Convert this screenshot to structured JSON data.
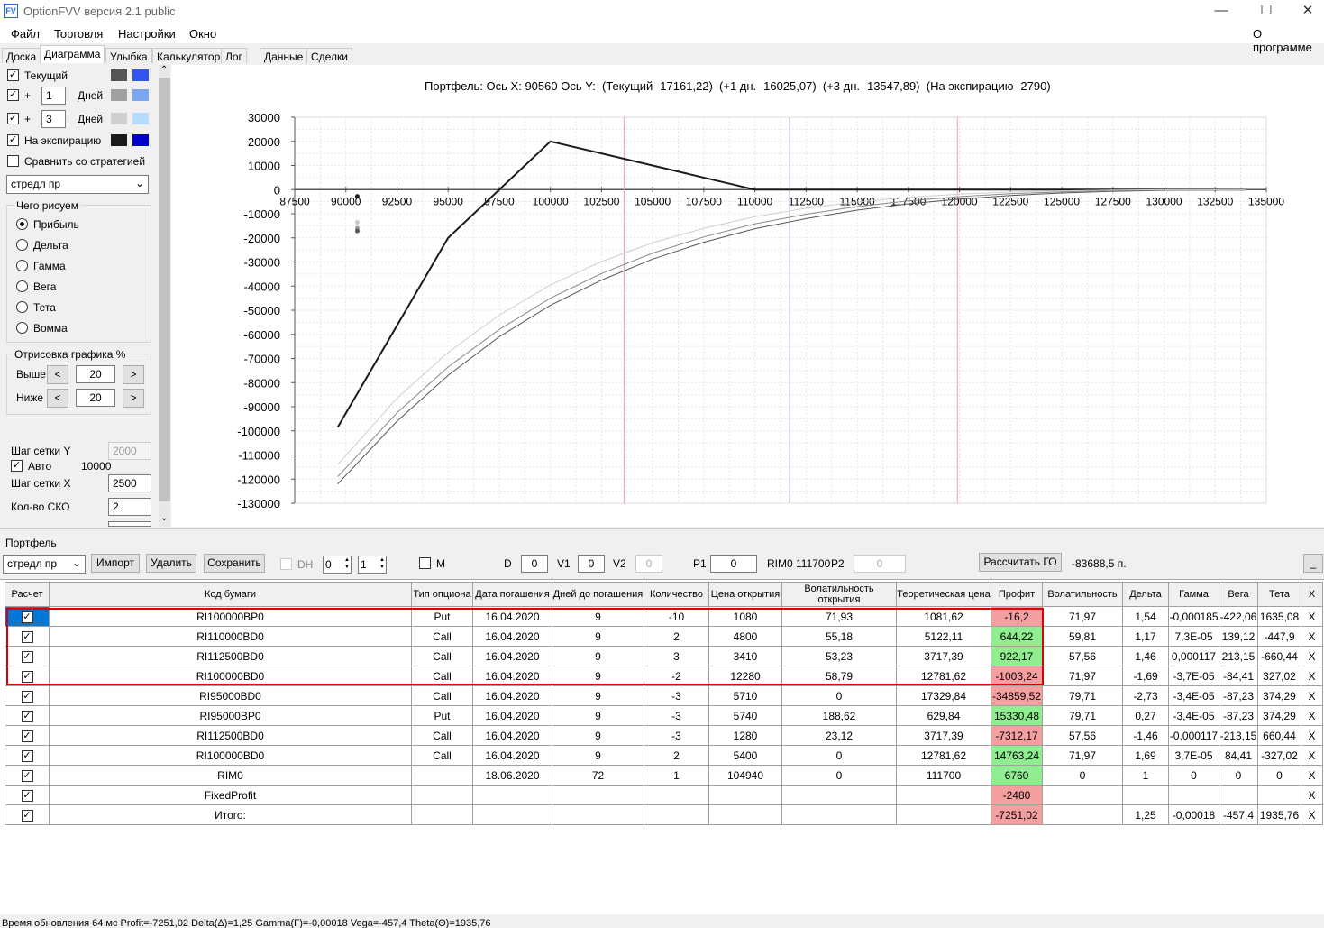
{
  "app": {
    "title": "OptionFVV версия 2.1 public",
    "icon_text": "FV"
  },
  "window_controls": {
    "minimize": "—",
    "maximize": "☐",
    "close": "✕"
  },
  "menu": {
    "items": [
      "Файл",
      "Торговля",
      "Настройки",
      "Окно"
    ],
    "about": "О программе"
  },
  "tabs": [
    "Доска",
    "Диаграмма",
    "Улыбка",
    "Калькулятор",
    "Лог",
    "Данные",
    "Сделки"
  ],
  "active_tab": "Диаграмма",
  "left_panel": {
    "current_label": "Текущий",
    "plus_sign": "+",
    "plus1_value": "1",
    "plus3_value": "3",
    "days_label": "Дней",
    "expiry_label": "На экспирацию",
    "compare_label": "Сравнить со стратегией",
    "strategy_select": "стредл пр",
    "draw_group_title": "Чего рисуем",
    "draw_options": [
      "Прибыль",
      "Дельта",
      "Гамма",
      "Вега",
      "Тета",
      "Вомма"
    ],
    "draw_selected": "Прибыль",
    "render_group_title": "Отрисовка графика %",
    "above_label": "Выше",
    "above_value": "20",
    "below_label": "Ниже",
    "below_value": "20",
    "prev_btn": "<",
    "next_btn": ">",
    "grid_y_label": "Шаг сетки Y",
    "grid_y_value": "2000",
    "auto_label": "Авто",
    "auto_value": "10000",
    "grid_x_label": "Шаг сетки X",
    "grid_x_value": "2500",
    "sko_label": "Кол-во СКО",
    "sko_value": "2",
    "truncated_value": "1",
    "swatch_colors": {
      "current": [
        "#555555",
        "#3355ee"
      ],
      "plus1": [
        "#a0a0a0",
        "#7ba7f0"
      ],
      "plus3": [
        "#cfcfcf",
        "#b6dcff"
      ],
      "expiry": [
        "#1a1a1a",
        "#0000cc"
      ]
    }
  },
  "chart_header": "Портфель: Ось X: 90560 Ось Y:  (Текущий -17161,22)  (+1 дн. -16025,07)  (+3 дн. -13547,89)  (На экспирацию -2790)",
  "chart_data": {
    "type": "line",
    "title": "Портфель: Ось X: 90560 Ось Y:  (Текущий -17161,22)  (+1 дн. -16025,07)  (+3 дн. -13547,89)  (На экспирацию -2790)",
    "xlim": [
      87500,
      135000
    ],
    "ylim": [
      -130000,
      30000
    ],
    "x_ticks": [
      "87500",
      "90000",
      "92500",
      "95000",
      "97500",
      "100000",
      "102500",
      "105000",
      "107500",
      "110000",
      "112500",
      "115000",
      "117500",
      "120000",
      "122500",
      "125000",
      "127500",
      "130000",
      "132500",
      "135000"
    ],
    "y_ticks": [
      "30000",
      "20000",
      "10000",
      "0",
      "-10000",
      "-20000",
      "-30000",
      "-40000",
      "-50000",
      "-60000",
      "-70000",
      "-80000",
      "-90000",
      "-100000",
      "-110000",
      "-120000",
      "-130000"
    ],
    "grid": true,
    "vlines": [
      {
        "x": 103600,
        "color": "#f4a0a0"
      },
      {
        "x": 111700,
        "color": "#7a8ba8"
      },
      {
        "x": 119900,
        "color": "#f4a0a0"
      }
    ],
    "series": [
      {
        "color": "#1a1a1a",
        "width": 2,
        "x": [
          89600,
          95000,
          100000,
          110000,
          134000
        ],
        "y": [
          -98500,
          -20000,
          20000,
          0,
          0
        ]
      },
      {
        "color": "#555555",
        "width": 1,
        "x": [
          89600,
          92500,
          95000,
          97500,
          100000,
          102500,
          105000,
          107500,
          110000,
          112500,
          115000,
          117500,
          120000,
          122500,
          125000,
          127500,
          130000,
          134000
        ],
        "y": [
          -122000,
          -96000,
          -77000,
          -61000,
          -48000,
          -37500,
          -28800,
          -21800,
          -16200,
          -12000,
          -8500,
          -5900,
          -3900,
          -2400,
          -1400,
          -700,
          -300,
          0
        ]
      },
      {
        "color": "#888888",
        "width": 1,
        "x": [
          89600,
          92500,
          95000,
          97500,
          100000,
          102500,
          105000,
          107500,
          110000,
          112500,
          115000,
          117500,
          120000,
          122500,
          125000,
          127500,
          130000,
          134000
        ],
        "y": [
          -119000,
          -92500,
          -73500,
          -58000,
          -45000,
          -34800,
          -26300,
          -19600,
          -14200,
          -10200,
          -7000,
          -4700,
          -2900,
          -1700,
          -900,
          -400,
          -150,
          0
        ]
      },
      {
        "color": "#cfcfcf",
        "width": 1,
        "x": [
          89600,
          92500,
          95000,
          97500,
          100000,
          102500,
          105000,
          107500,
          110000,
          112500,
          115000,
          117500,
          120000,
          122500,
          125000,
          127500,
          130000,
          134000
        ],
        "y": [
          -114000,
          -86500,
          -67500,
          -52000,
          -39500,
          -29800,
          -22000,
          -16000,
          -11200,
          -7700,
          -5100,
          -3200,
          -1900,
          -1000,
          -500,
          -200,
          -50,
          0
        ]
      }
    ],
    "markers": [
      {
        "x": 90560,
        "y": -2790,
        "color": "#1a1a1a"
      },
      {
        "x": 90560,
        "y": -13547.89,
        "color": "#c8c8c8"
      },
      {
        "x": 90560,
        "y": -16025.07,
        "color": "#999999"
      },
      {
        "x": 90560,
        "y": -17161.22,
        "color": "#555555"
      }
    ]
  },
  "portfolio": {
    "label": "Портфель",
    "select_value": "стредл пр",
    "import_btn": "Импорт",
    "delete_btn": "Удалить",
    "save_btn": "Сохранить",
    "dh_label": "DH",
    "spin1": "0",
    "spin2": "1",
    "m_label": "M",
    "d_label": "D",
    "d_value": "0",
    "v1_label": "V1",
    "v1_value": "0",
    "v2_label": "V2",
    "v2_value": "0",
    "p1_label": "P1",
    "p1_value": "0",
    "rim_text": "RIM0 111700",
    "p2_label": "P2",
    "p2_value": "0",
    "calc_btn": "Рассчитать ГО",
    "go_value": "-83688,5 п.",
    "min_btn": "_",
    "spin_up": "▲",
    "spin_down": "▼"
  },
  "table": {
    "headers": [
      "Расчет",
      "Код бумаги",
      "Тип опциона",
      "Дата погашения",
      "Дней до погашения",
      "Количество",
      "Цена открытия",
      "Волатильность открытия",
      "Теоретическая цена",
      "Профит",
      "Волатильность",
      "Дельта",
      "Гамма",
      "Вега",
      "Тета",
      "X"
    ],
    "rows": [
      {
        "code": "RI100000BP0",
        "type": "Put",
        "date": "16.04.2020",
        "days": "9",
        "qty": "-10",
        "price": "1080",
        "vol_open": "71,93",
        "theor": "1081,62",
        "profit": "-16,2",
        "pstate": "neg",
        "vol": "71,97",
        "delta": "1,54",
        "gamma": "-0,000185",
        "vega": "-422,06",
        "theta": "1635,08"
      },
      {
        "code": "RI110000BD0",
        "type": "Call",
        "date": "16.04.2020",
        "days": "9",
        "qty": "2",
        "price": "4800",
        "vol_open": "55,18",
        "theor": "5122,11",
        "profit": "644,22",
        "pstate": "pos",
        "vol": "59,81",
        "delta": "1,17",
        "gamma": "7,3E-05",
        "vega": "139,12",
        "theta": "-447,9"
      },
      {
        "code": "RI112500BD0",
        "type": "Call",
        "date": "16.04.2020",
        "days": "9",
        "qty": "3",
        "price": "3410",
        "vol_open": "53,23",
        "theor": "3717,39",
        "profit": "922,17",
        "pstate": "pos",
        "vol": "57,56",
        "delta": "1,46",
        "gamma": "0,000117",
        "vega": "213,15",
        "theta": "-660,44"
      },
      {
        "code": "RI100000BD0",
        "type": "Call",
        "date": "16.04.2020",
        "days": "9",
        "qty": "-2",
        "price": "12280",
        "vol_open": "58,79",
        "theor": "12781,62",
        "profit": "-1003,24",
        "pstate": "neg",
        "vol": "71,97",
        "delta": "-1,69",
        "gamma": "-3,7E-05",
        "vega": "-84,41",
        "theta": "327,02"
      },
      {
        "code": "RI95000BD0",
        "type": "Call",
        "date": "16.04.2020",
        "days": "9",
        "qty": "-3",
        "price": "5710",
        "vol_open": "0",
        "theor": "17329,84",
        "profit": "-34859,52",
        "pstate": "neg",
        "vol": "79,71",
        "delta": "-2,73",
        "gamma": "-3,4E-05",
        "vega": "-87,23",
        "theta": "374,29"
      },
      {
        "code": "RI95000BP0",
        "type": "Put",
        "date": "16.04.2020",
        "days": "9",
        "qty": "-3",
        "price": "5740",
        "vol_open": "188,62",
        "theor": "629,84",
        "profit": "15330,48",
        "pstate": "pos",
        "vol": "79,71",
        "delta": "0,27",
        "gamma": "-3,4E-05",
        "vega": "-87,23",
        "theta": "374,29"
      },
      {
        "code": "RI112500BD0",
        "type": "Call",
        "date": "16.04.2020",
        "days": "9",
        "qty": "-3",
        "price": "1280",
        "vol_open": "23,12",
        "theor": "3717,39",
        "profit": "-7312,17",
        "pstate": "neg",
        "vol": "57,56",
        "delta": "-1,46",
        "gamma": "-0,000117",
        "vega": "-213,15",
        "theta": "660,44"
      },
      {
        "code": "RI100000BD0",
        "type": "Call",
        "date": "16.04.2020",
        "days": "9",
        "qty": "2",
        "price": "5400",
        "vol_open": "0",
        "theor": "12781,62",
        "profit": "14763,24",
        "pstate": "pos",
        "vol": "71,97",
        "delta": "1,69",
        "gamma": "3,7E-05",
        "vega": "84,41",
        "theta": "-327,02"
      },
      {
        "code": "RIM0",
        "type": "",
        "date": "18.06.2020",
        "days": "72",
        "qty": "1",
        "price": "104940",
        "vol_open": "0",
        "theor": "111700",
        "profit": "6760",
        "pstate": "pos",
        "vol": "0",
        "delta": "1",
        "gamma": "0",
        "vega": "0",
        "theta": "0"
      },
      {
        "code": "FixedProfit",
        "type": "",
        "date": "",
        "days": "",
        "qty": "",
        "price": "",
        "vol_open": "",
        "theor": "",
        "profit": "-2480",
        "pstate": "neg",
        "vol": "",
        "delta": "",
        "gamma": "",
        "vega": "",
        "theta": ""
      },
      {
        "code": "Итого:",
        "type": "",
        "date": "",
        "days": "",
        "qty": "",
        "price": "",
        "vol_open": "",
        "theor": "",
        "profit": "-7251,02",
        "pstate": "neg",
        "vol": "",
        "delta": "1,25",
        "gamma": "-0,00018",
        "vega": "-457,4",
        "theta": "1935,76"
      }
    ],
    "remove_label": "X",
    "check_mark": "✓"
  },
  "status": "Время обновления 64 мс  Profit=-7251,02 Delta(Δ)=1,25 Gamma(Γ)=-0,00018 Vega=-457,4 Theta(Θ)=1935,76",
  "highlight_color": "#e00000"
}
